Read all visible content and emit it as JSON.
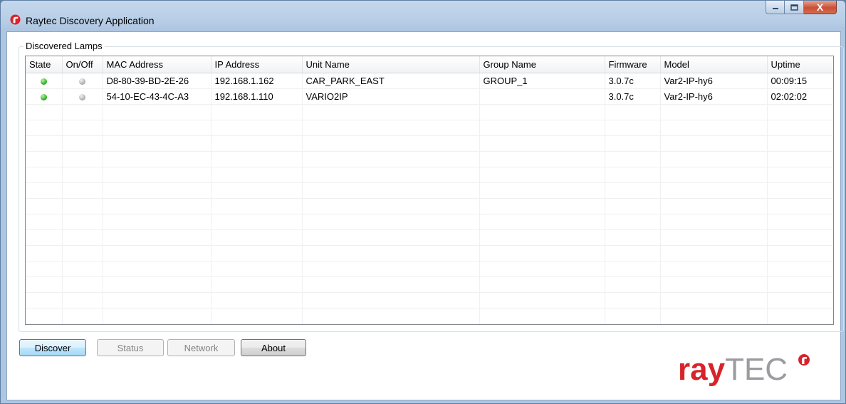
{
  "window": {
    "title": "Raytec Discovery Application",
    "close_glyph": "X"
  },
  "group": {
    "label": "Discovered Lamps"
  },
  "table": {
    "columns": [
      "State",
      "On/Off",
      "MAC Address",
      "IP Address",
      "Unit Name",
      "Group Name",
      "Firmware",
      "Model",
      "Uptime"
    ],
    "rows": [
      {
        "state": "green",
        "onoff": "grey",
        "mac": "D8-80-39-BD-2E-26",
        "ip": "192.168.1.162",
        "unit": "CAR_PARK_EAST",
        "group": "GROUP_1",
        "firmware": "3.0.7c",
        "model": "Var2-IP-hy6",
        "uptime": "00:09:15"
      },
      {
        "state": "green",
        "onoff": "grey",
        "mac": "54-10-EC-43-4C-A3",
        "ip": "192.168.1.110",
        "unit": "VARIO2IP",
        "group": "",
        "firmware": "3.0.7c",
        "model": "Var2-IP-hy6",
        "uptime": "02:02:02"
      }
    ]
  },
  "buttons": {
    "discover": "Discover",
    "status": "Status",
    "network": "Network",
    "about": "About"
  },
  "logo": {
    "text_primary": "ray",
    "text_secondary": "TEC",
    "color_primary": "#d8232a",
    "color_secondary": "#9b9ca0"
  },
  "status_colors": {
    "green": "#33b52a",
    "grey": "#b4b4b4"
  }
}
